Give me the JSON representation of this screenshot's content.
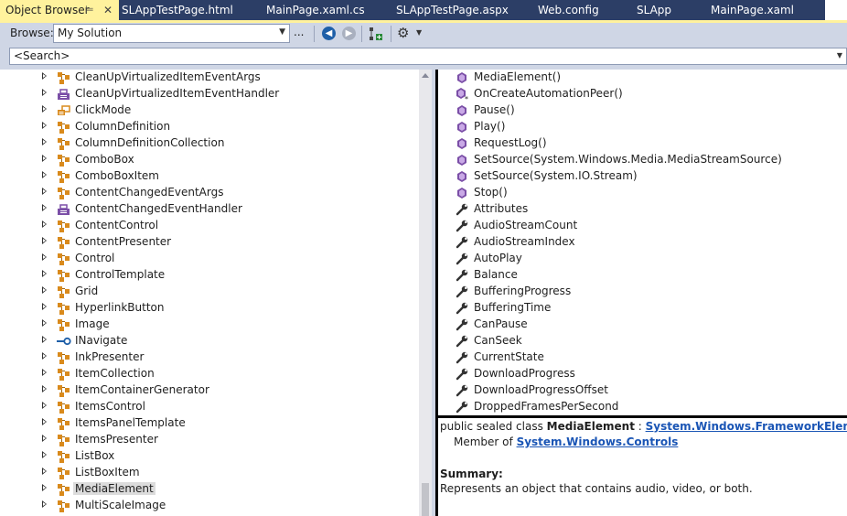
{
  "tabs": [
    {
      "label": "Object Browser",
      "active": true
    },
    {
      "label": "SLAppTestPage.html"
    },
    {
      "label": "MainPage.xaml.cs"
    },
    {
      "label": "SLAppTestPage.aspx"
    },
    {
      "label": "Web.config"
    },
    {
      "label": "SLApp"
    },
    {
      "label": "MainPage.xaml"
    }
  ],
  "toolbar": {
    "browse_label": "Browse:",
    "browse_value": "My Solution",
    "ellipsis_label": "..."
  },
  "search": {
    "value": "<Search>"
  },
  "tree": [
    {
      "label": "CleanUpVirtualizedItemEventArgs",
      "icon": "class-icon"
    },
    {
      "label": "CleanUpVirtualizedItemEventHandler",
      "icon": "delegate-icon"
    },
    {
      "label": "ClickMode",
      "icon": "enum-icon"
    },
    {
      "label": "ColumnDefinition",
      "icon": "class-icon"
    },
    {
      "label": "ColumnDefinitionCollection",
      "icon": "class-icon"
    },
    {
      "label": "ComboBox",
      "icon": "class-icon"
    },
    {
      "label": "ComboBoxItem",
      "icon": "class-icon"
    },
    {
      "label": "ContentChangedEventArgs",
      "icon": "class-icon"
    },
    {
      "label": "ContentChangedEventHandler",
      "icon": "delegate-icon"
    },
    {
      "label": "ContentControl",
      "icon": "class-icon"
    },
    {
      "label": "ContentPresenter",
      "icon": "class-icon"
    },
    {
      "label": "Control",
      "icon": "class-icon"
    },
    {
      "label": "ControlTemplate",
      "icon": "class-icon"
    },
    {
      "label": "Grid",
      "icon": "class-icon"
    },
    {
      "label": "HyperlinkButton",
      "icon": "class-icon"
    },
    {
      "label": "Image",
      "icon": "class-icon"
    },
    {
      "label": "INavigate",
      "icon": "interface-icon"
    },
    {
      "label": "InkPresenter",
      "icon": "class-icon"
    },
    {
      "label": "ItemCollection",
      "icon": "class-icon"
    },
    {
      "label": "ItemContainerGenerator",
      "icon": "class-icon"
    },
    {
      "label": "ItemsControl",
      "icon": "class-icon"
    },
    {
      "label": "ItemsPanelTemplate",
      "icon": "class-icon"
    },
    {
      "label": "ItemsPresenter",
      "icon": "class-icon"
    },
    {
      "label": "ListBox",
      "icon": "class-icon"
    },
    {
      "label": "ListBoxItem",
      "icon": "class-icon"
    },
    {
      "label": "MediaElement",
      "icon": "class-icon",
      "selected": true
    },
    {
      "label": "MultiScaleImage",
      "icon": "class-icon"
    }
  ],
  "members": [
    {
      "label": "MediaElement()",
      "icon": "method-icon"
    },
    {
      "label": "OnCreateAutomationPeer()",
      "icon": "protected-method-icon"
    },
    {
      "label": "Pause()",
      "icon": "method-icon"
    },
    {
      "label": "Play()",
      "icon": "method-icon"
    },
    {
      "label": "RequestLog()",
      "icon": "method-icon"
    },
    {
      "label": "SetSource(System.Windows.Media.MediaStreamSource)",
      "icon": "method-icon"
    },
    {
      "label": "SetSource(System.IO.Stream)",
      "icon": "method-icon"
    },
    {
      "label": "Stop()",
      "icon": "method-icon"
    },
    {
      "label": "Attributes",
      "icon": "property-icon"
    },
    {
      "label": "AudioStreamCount",
      "icon": "property-icon"
    },
    {
      "label": "AudioStreamIndex",
      "icon": "property-icon"
    },
    {
      "label": "AutoPlay",
      "icon": "property-icon"
    },
    {
      "label": "Balance",
      "icon": "property-icon"
    },
    {
      "label": "BufferingProgress",
      "icon": "property-icon"
    },
    {
      "label": "BufferingTime",
      "icon": "property-icon"
    },
    {
      "label": "CanPause",
      "icon": "property-icon"
    },
    {
      "label": "CanSeek",
      "icon": "property-icon"
    },
    {
      "label": "CurrentState",
      "icon": "property-icon"
    },
    {
      "label": "DownloadProgress",
      "icon": "property-icon"
    },
    {
      "label": "DownloadProgressOffset",
      "icon": "property-icon"
    },
    {
      "label": "DroppedFramesPerSecond",
      "icon": "property-icon"
    }
  ],
  "description": {
    "decl_prefix": "public sealed class ",
    "class_name": "MediaElement",
    "decl_sep": " : ",
    "base_class": "System.Windows.FrameworkElement",
    "member_of_label": "Member of ",
    "namespace": "System.Windows.Controls",
    "summary_heading": "Summary:",
    "summary_text": "Represents an object that contains audio, video, or both."
  },
  "colors": {
    "tab_strip": "#2c3e66",
    "active_tab": "#fff29d",
    "toolbar": "#cfd6e5",
    "link": "#1a55b5",
    "class_icon": "#d98a1c",
    "member_icon": "#7b4fa7"
  }
}
